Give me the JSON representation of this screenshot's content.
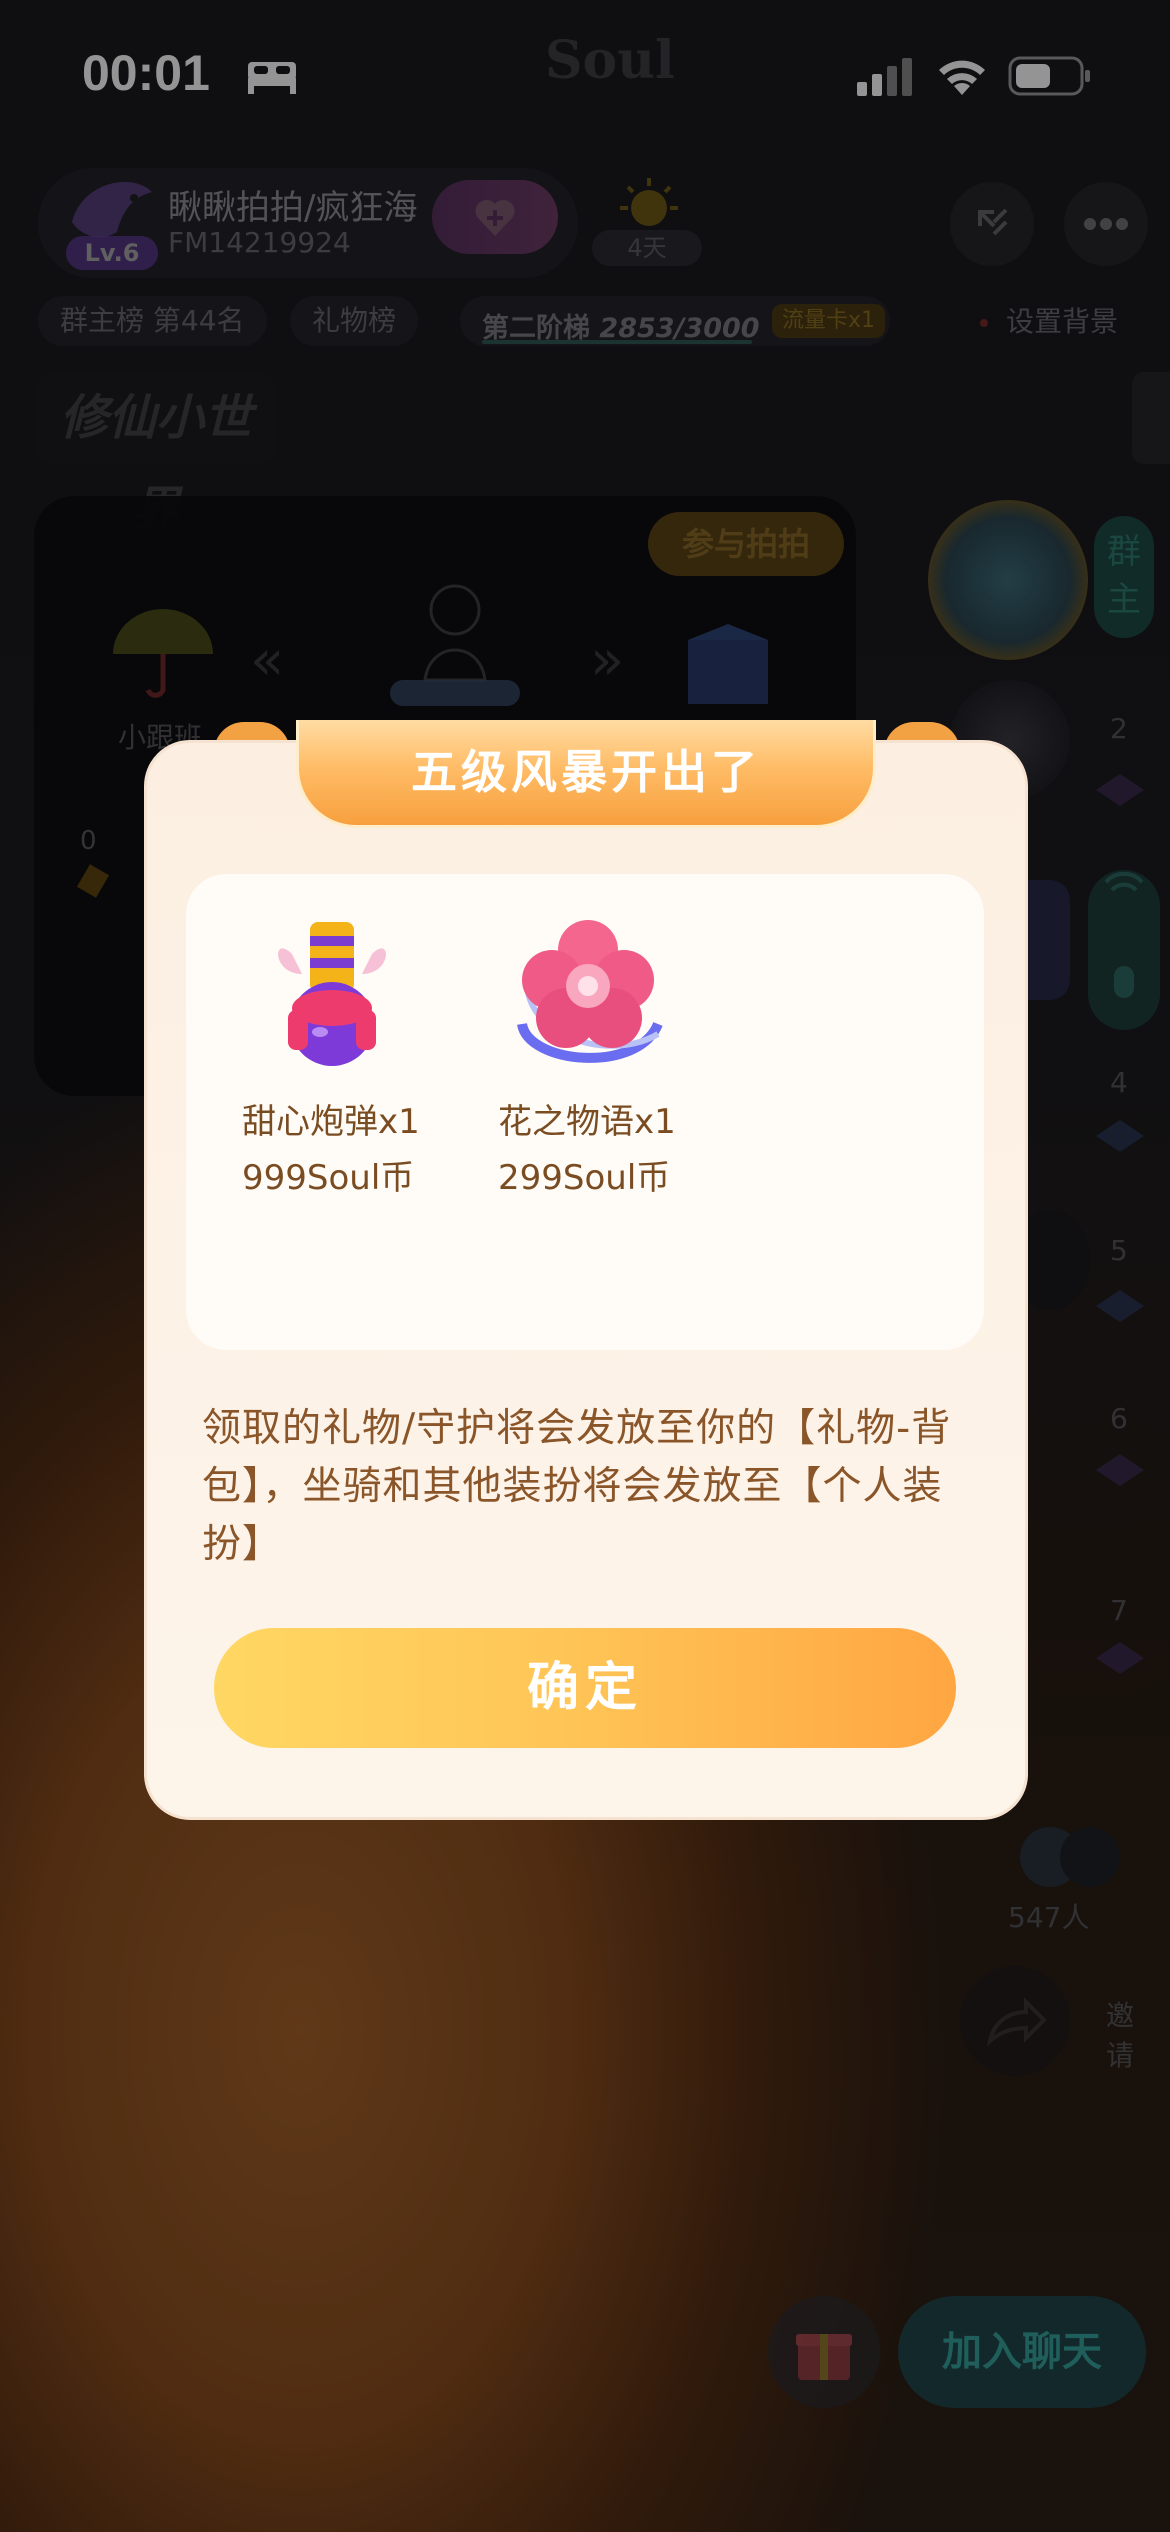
{
  "status_bar": {
    "time": "00:01",
    "app_logo": "Soul"
  },
  "room": {
    "name": "瞅瞅拍拍/疯狂海",
    "id": "FM14219924",
    "level": "Lv.6",
    "streak_days": "4天",
    "chips": {
      "rank": "群主榜 第44名",
      "gift_rank": "礼物榜",
      "stage": "第二阶梯",
      "stage_progress": "2853/3000",
      "stage_tag": "流量卡x1",
      "set_background": "设置背景"
    },
    "game_banner": "修仙小世界",
    "join_pai": "参与拍拍",
    "umbrella_label": "小跟班",
    "counter": "0",
    "host_tag": "群主",
    "mic_numbers": [
      "2",
      "4",
      "5",
      "6",
      "7"
    ],
    "online_count": "547人",
    "invite_label": "邀请",
    "join_chat": "加入聊天"
  },
  "modal": {
    "title": "五级风暴开出了",
    "gifts": [
      {
        "name": "甜心炮弹x1",
        "price": "999Soul币",
        "icon": "candy-bomb-icon"
      },
      {
        "name": "花之物语x1",
        "price": "299Soul币",
        "icon": "flower-icon"
      }
    ],
    "note": "领取的礼物/守护将会发放至你的【礼物-背包】，坐骑和其他装扮将会发放至【个人装扮】",
    "confirm_label": "确定"
  },
  "colors": {
    "modal_bg": "#fdf2e6",
    "title_orange": "#f7a03e",
    "text_brown": "#7a4c22",
    "confirm_gradient_start": "#ffd763",
    "confirm_gradient_end": "#ffa642"
  }
}
